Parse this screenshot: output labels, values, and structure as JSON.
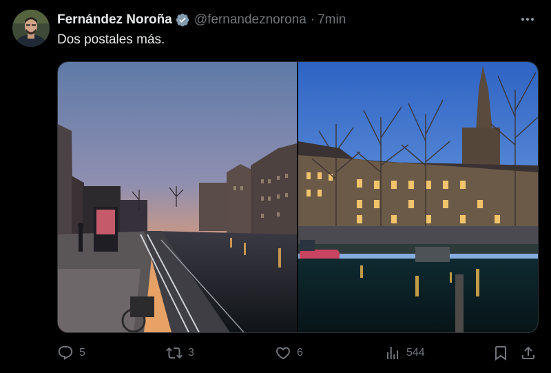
{
  "post": {
    "author_name": "Fernández Noroña",
    "handle": "@fernandeznorona",
    "separator": "·",
    "time": "7min",
    "text": "Dos postales más."
  },
  "stats": {
    "replies": "5",
    "reposts": "3",
    "likes": "6",
    "views": "544"
  },
  "icons": {
    "verified": "verified-badge-icon",
    "more": "more-options-icon",
    "reply": "reply-icon",
    "repost": "repost-icon",
    "like": "heart-icon",
    "views": "views-icon",
    "bookmark": "bookmark-icon",
    "share": "share-icon"
  },
  "colors": {
    "background": "#000000",
    "text": "#e7e9ea",
    "secondary": "#71767b",
    "verified": "#829aab"
  }
}
